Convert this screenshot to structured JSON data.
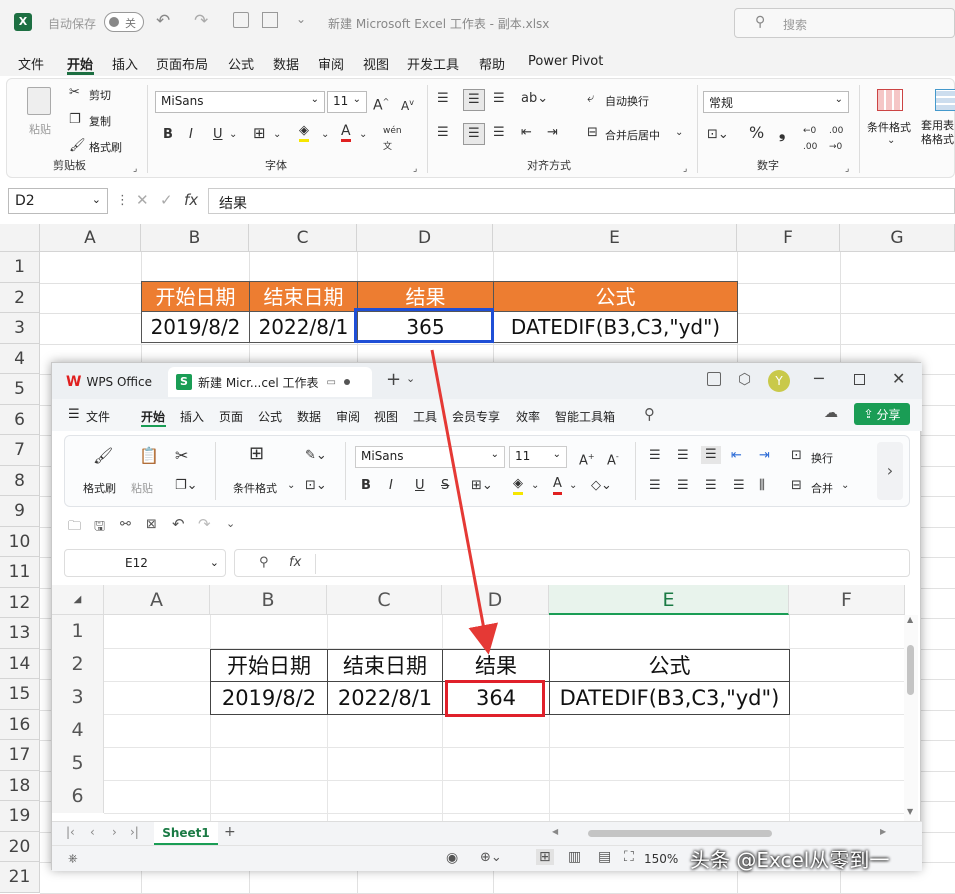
{
  "excel": {
    "autosave_label": "自动保存",
    "autosave_state": "关",
    "doc_title": "新建 Microsoft Excel 工作表 - 副本.xlsx",
    "search_placeholder": "搜索",
    "tabs": [
      "文件",
      "开始",
      "插入",
      "页面布局",
      "公式",
      "数据",
      "审阅",
      "视图",
      "开发工具",
      "帮助",
      "Power Pivot"
    ],
    "clipboard": {
      "paste": "粘贴",
      "cut": "剪切",
      "copy": "复制",
      "format_painter": "格式刷",
      "group": "剪贴板"
    },
    "font": {
      "name": "MiSans",
      "size": "11",
      "group": "字体"
    },
    "alignment": {
      "wrap": "自动换行",
      "merge": "合并后居中",
      "group": "对齐方式"
    },
    "number": {
      "format": "常规",
      "group": "数字"
    },
    "styles": {
      "conditional": "条件格式",
      "table": "套用表格格式"
    },
    "namebox": "D2",
    "formula": "结果",
    "columns": [
      "A",
      "B",
      "C",
      "D",
      "E",
      "F",
      "G"
    ],
    "rows": [
      "1",
      "2",
      "3",
      "4",
      "5",
      "6",
      "7",
      "8",
      "9",
      "10",
      "11",
      "12",
      "13",
      "14",
      "15",
      "16",
      "17",
      "18",
      "19",
      "20",
      "21"
    ],
    "table": {
      "headers": [
        "开始日期",
        "结束日期",
        "结果",
        "公式"
      ],
      "values": [
        "2019/8/2",
        "2022/8/1",
        "365",
        "DATEDIF(B3,C3,\"yd\")"
      ]
    }
  },
  "wps": {
    "app_tab": "WPS Office",
    "doc_tab": "新建 Micr...cel 工作表",
    "user_initial": "Y",
    "menu": [
      "文件",
      "开始",
      "插入",
      "页面",
      "公式",
      "数据",
      "审阅",
      "视图",
      "工具",
      "会员专享",
      "效率",
      "智能工具箱"
    ],
    "share": "分享",
    "ribbon": {
      "format_painter": "格式刷",
      "paste": "粘贴",
      "conditional": "条件格式",
      "font": "MiSans",
      "size": "11",
      "wrap": "换行",
      "merge": "合并"
    },
    "namebox": "E12",
    "columns": [
      "A",
      "B",
      "C",
      "D",
      "E",
      "F"
    ],
    "rows": [
      "1",
      "2",
      "3",
      "4",
      "5",
      "6"
    ],
    "table": {
      "headers": [
        "开始日期",
        "结束日期",
        "结果",
        "公式"
      ],
      "values": [
        "2019/8/2",
        "2022/8/1",
        "364",
        "DATEDIF(B3,C3,\"yd\")"
      ]
    },
    "sheet": "Sheet1",
    "zoom": "150%"
  },
  "watermark": "头条 @Excel从零到一",
  "colors": {
    "header_orange": "#ed7d31",
    "excel_highlight": "#1f4fd6",
    "wps_highlight": "#e0202a",
    "arrow": "#e53935",
    "wps_green": "#1a9d55"
  }
}
